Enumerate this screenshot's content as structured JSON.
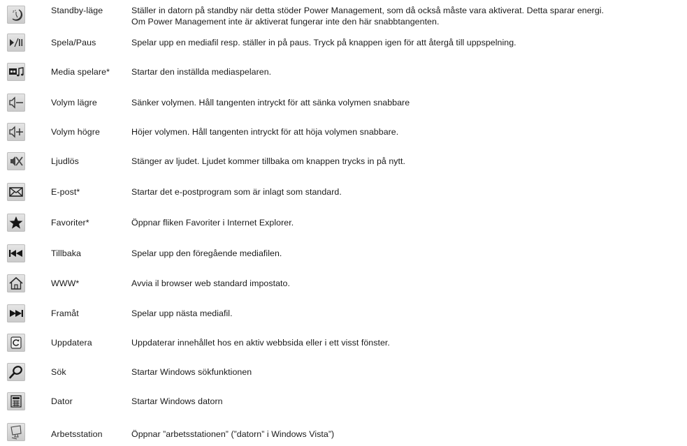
{
  "rows": [
    {
      "icon": "standby-icon",
      "name": "Standby-läge",
      "desc": [
        "Ställer in datorn på standby när detta stöder Power Management, som då också måste vara aktiverat. Detta sparar energi.",
        "Om Power Management inte är aktiverat fungerar inte den här snabbtangenten."
      ]
    },
    {
      "icon": "play-pause-icon",
      "name": "Spela/Paus",
      "desc": [
        "Spelar upp en mediafil resp. ställer in på paus. Tryck på knappen igen för att återgå till uppspelning."
      ]
    },
    {
      "icon": "media-player-icon",
      "name": "Media spelare*",
      "desc": [
        "Startar den inställda mediaspelaren."
      ]
    },
    {
      "icon": "volume-down-icon",
      "name": "Volym  lägre",
      "desc": [
        "Sänker volymen. Håll tangenten intryckt för att sänka volymen  snabbare"
      ]
    },
    {
      "icon": "volume-up-icon",
      "name": "Volym  högre",
      "desc": [
        "Höjer volymen. Håll tangenten intryckt för att höja volymen snabbare."
      ]
    },
    {
      "icon": "mute-icon",
      "name": "Ljudlös",
      "desc": [
        "Stänger av ljudet. Ljudet kommer tillbaka om knappen trycks in på nytt."
      ]
    },
    {
      "icon": "email-icon",
      "name": "E-post*",
      "desc": [
        "Startar det e-postprogram som är inlagt som standard."
      ]
    },
    {
      "icon": "favorites-star-icon",
      "name": "Favoriter*",
      "desc": [
        "Öppnar fliken Favoriter i Internet Explorer."
      ]
    },
    {
      "icon": "previous-track-icon",
      "name": "Tillbaka",
      "desc": [
        "Spelar upp den föregående mediafilen."
      ]
    },
    {
      "icon": "home-icon",
      "name": "WWW*",
      "desc": [
        "Avvia il browser web standard impostato."
      ]
    },
    {
      "icon": "next-track-icon",
      "name": "Framåt",
      "desc": [
        "Spelar upp nästa mediafil."
      ]
    },
    {
      "icon": "refresh-icon",
      "name": "Uppdatera",
      "desc": [
        "Uppdaterar innehållet hos en aktiv webbsida eller i ett visst fönster."
      ]
    },
    {
      "icon": "search-magnifier-icon",
      "name": "Sök",
      "desc": [
        "Startar Windows sökfunktionen"
      ]
    },
    {
      "icon": "calculator-icon",
      "name": "Dator",
      "desc": [
        "Startar Windows datorn"
      ]
    },
    {
      "icon": "workstation-icon",
      "name": "Arbetsstation",
      "desc": [
        "Öppnar ”arbetsstationen” (”datorn” i Windows Vista”)"
      ]
    }
  ]
}
